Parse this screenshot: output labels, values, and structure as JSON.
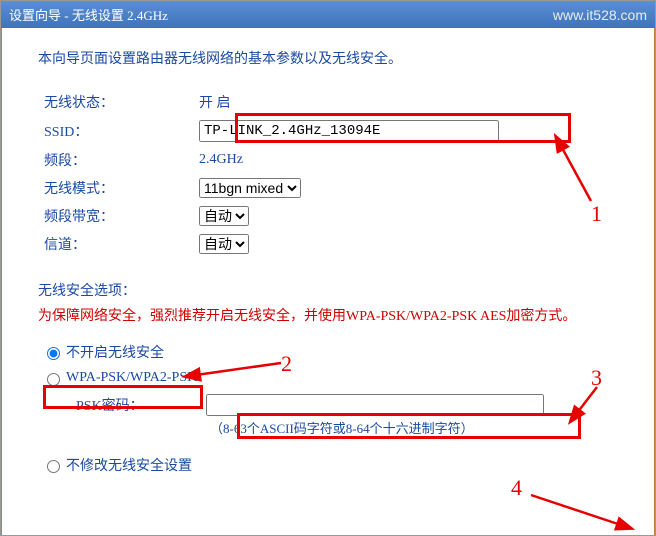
{
  "titlebar": {
    "title": "设置向导 - 无线设置 2.4GHz",
    "watermark": "www.it528.com"
  },
  "intro": "本向导页面设置路由器无线网络的基本参数以及无线安全。",
  "fields": {
    "wireless_status_label": "无线状态：",
    "wireless_status_value": "开  启",
    "ssid_label": "SSID：",
    "ssid_value": "TP-LINK_2.4GHz_13094E",
    "band_label": "频段：",
    "band_value": "2.4GHz",
    "mode_label": "无线模式：",
    "mode_value": "11bgn mixed",
    "bandwidth_label": "频段带宽：",
    "bandwidth_value": "自动",
    "channel_label": "信道：",
    "channel_value": "自动"
  },
  "security": {
    "title": "无线安全选项：",
    "warn": "为保障网络安全，强烈推荐开启无线安全，并使用WPA-PSK/WPA2-PSK AES加密方式。",
    "opt_none": "不开启无线安全",
    "opt_wpa": "WPA-PSK/WPA2-PSK",
    "psk_label": "PSK密码：",
    "psk_value": "",
    "psk_hint": "（8-63个ASCII码字符或8-64个十六进制字符）",
    "opt_keep": "不修改无线安全设置"
  },
  "annotations": {
    "n1": "1",
    "n2": "2",
    "n3": "3",
    "n4": "4"
  }
}
